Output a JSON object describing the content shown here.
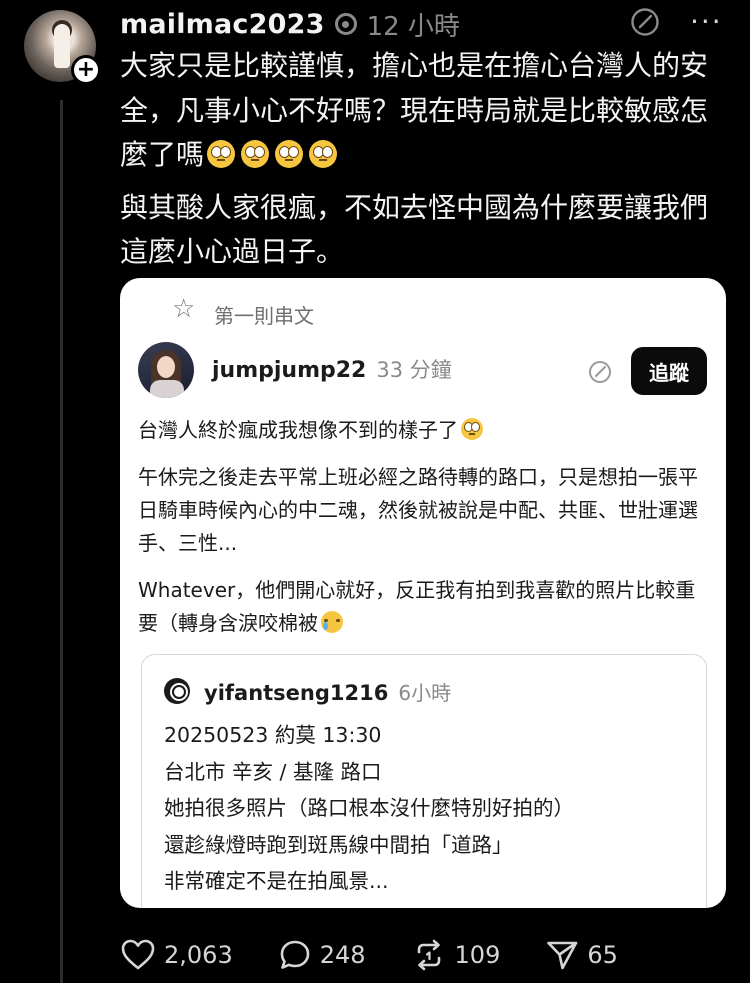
{
  "post": {
    "username": "mailmac2023",
    "timestamp": "12 小時",
    "paragraph1": "大家只是比較謹慎，擔心也是在擔心台灣人的安全，凡事小心不好嗎？現在時局就是比較敏感怎麼了嗎",
    "paragraph2": "與其酸人家很瘋，不如去怪中國為什麼要讓我們這麼小心過日子。",
    "avatar_icon": "avatar",
    "follow_icon": "plus-icon",
    "more_label": "···"
  },
  "quoted": {
    "label": "第一則串文",
    "username": "jumpjump22",
    "timestamp": "33 分鐘",
    "follow_label": "追蹤",
    "line1": "台灣人終於瘋成我想像不到的樣子了",
    "para2": "午休完之後走去平常上班必經之路待轉的路口，只是想拍一張平日騎車時候內心的中二魂，然後就被說是中配、共匪、世壯運選手、三性...",
    "para3": "Whatever，他們開心就好，反正我有拍到我喜歡的照片比較重要（轉身含淚咬棉被",
    "nested": {
      "username": "yifantseng1216",
      "timestamp": "6小時",
      "lines": [
        "20250523 約莫 13:30",
        "台北市 辛亥 / 基隆 路口",
        "她拍很多照片（路口根本沒什麼特別好拍的）",
        "還趁綠燈時跑到斑馬線中間拍「道路」",
        "非常確定不是在拍風景..."
      ]
    }
  },
  "actions": {
    "likes": "2,063",
    "comments": "248",
    "reposts": "109",
    "shares": "65"
  }
}
